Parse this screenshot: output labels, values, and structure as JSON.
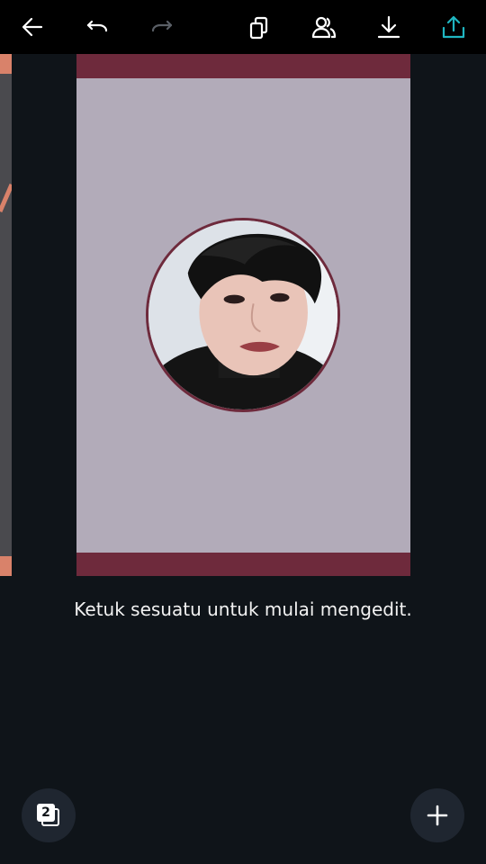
{
  "toolbar": {
    "icons": [
      "back-arrow-icon",
      "undo-icon",
      "redo-icon",
      "duplicate-page-icon",
      "share-people-icon",
      "download-icon",
      "upload-share-icon"
    ],
    "accent": "#1fb6c1"
  },
  "canvas": {
    "background": "#b2abb9",
    "band_color": "#6e2a3c"
  },
  "main": {
    "hint_text": "Ketuk sesuatu untuk mulai mengedit."
  },
  "footer": {
    "page_count": "2",
    "add_icon": "plus-icon"
  }
}
